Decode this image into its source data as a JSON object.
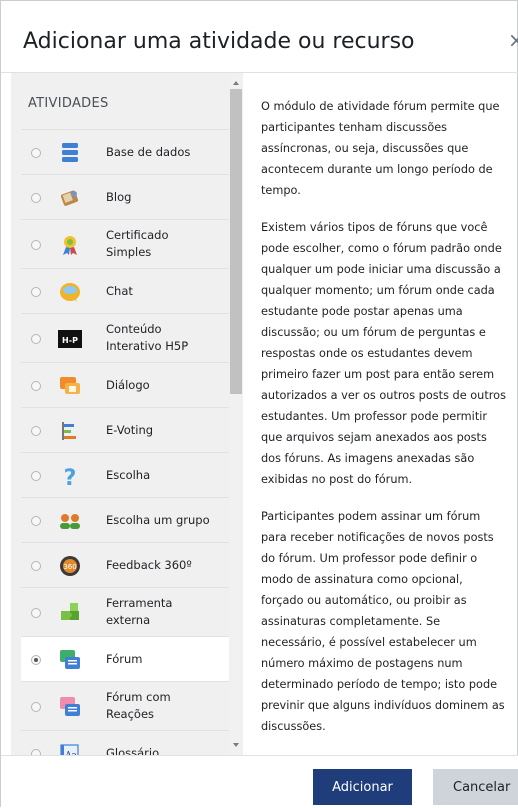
{
  "modal": {
    "title": "Adicionar uma atividade ou recurso",
    "close_glyph": "×"
  },
  "activities": {
    "section_title": "ATIVIDADES",
    "items": [
      {
        "label": "Base de dados",
        "icon": "database-icon",
        "selected": false
      },
      {
        "label": "Blog",
        "icon": "blog-icon",
        "selected": false
      },
      {
        "label": "Certificado Simples",
        "icon": "certificate-icon",
        "selected": false
      },
      {
        "label": "Chat",
        "icon": "chat-icon",
        "selected": false
      },
      {
        "label": "Conteúdo Interativo H5P",
        "icon": "h5p-icon",
        "selected": false
      },
      {
        "label": "Diálogo",
        "icon": "dialogue-icon",
        "selected": false
      },
      {
        "label": "E-Voting",
        "icon": "evoting-icon",
        "selected": false
      },
      {
        "label": "Escolha",
        "icon": "question-icon",
        "selected": false
      },
      {
        "label": "Escolha um grupo",
        "icon": "group-choice-icon",
        "selected": false
      },
      {
        "label": "Feedback 360º",
        "icon": "feedback360-icon",
        "selected": false
      },
      {
        "label": "Ferramenta externa",
        "icon": "puzzle-icon",
        "selected": false
      },
      {
        "label": "Fórum",
        "icon": "forum-icon",
        "selected": true
      },
      {
        "label": "Fórum com Reações",
        "icon": "forum-reactions-icon",
        "selected": false
      },
      {
        "label": "Glossário",
        "icon": "glossary-icon",
        "selected": false
      }
    ]
  },
  "help": {
    "paragraphs": [
      "O módulo de atividade fórum permite que participantes tenham discussões assíncronas, ou seja, discussões que acontecem durante um longo período de tempo.",
      "Existem vários tipos de fóruns que você pode escolher, como o fórum padrão onde qualquer um pode iniciar uma discussão a qualquer momento; um fórum onde cada estudante pode postar apenas uma discussão; ou um fórum de perguntas e respostas onde os estudantes devem primeiro fazer um post para então serem autorizados a ver os outros posts de outros estudantes. Um professor pode permitir que arquivos sejam anexados aos posts dos fóruns. As imagens anexadas são exibidas no post do fórum.",
      "Participantes podem assinar um fórum para receber notificações de novos posts do fórum. Um professor pode definir o modo de assinatura como opcional, forçado ou automático, ou proibir as assinaturas completamente. Se necessário, é possível estabelecer um número máximo de postagens num determinado período de tempo; isto pode previnir que alguns indivíduos dominem as discussões."
    ]
  },
  "footer": {
    "add_label": "Adicionar",
    "cancel_label": "Cancelar"
  },
  "colors": {
    "primary": "#1f3d7a",
    "secondary": "#ced4da",
    "panel_bg": "#f0f0f0"
  }
}
